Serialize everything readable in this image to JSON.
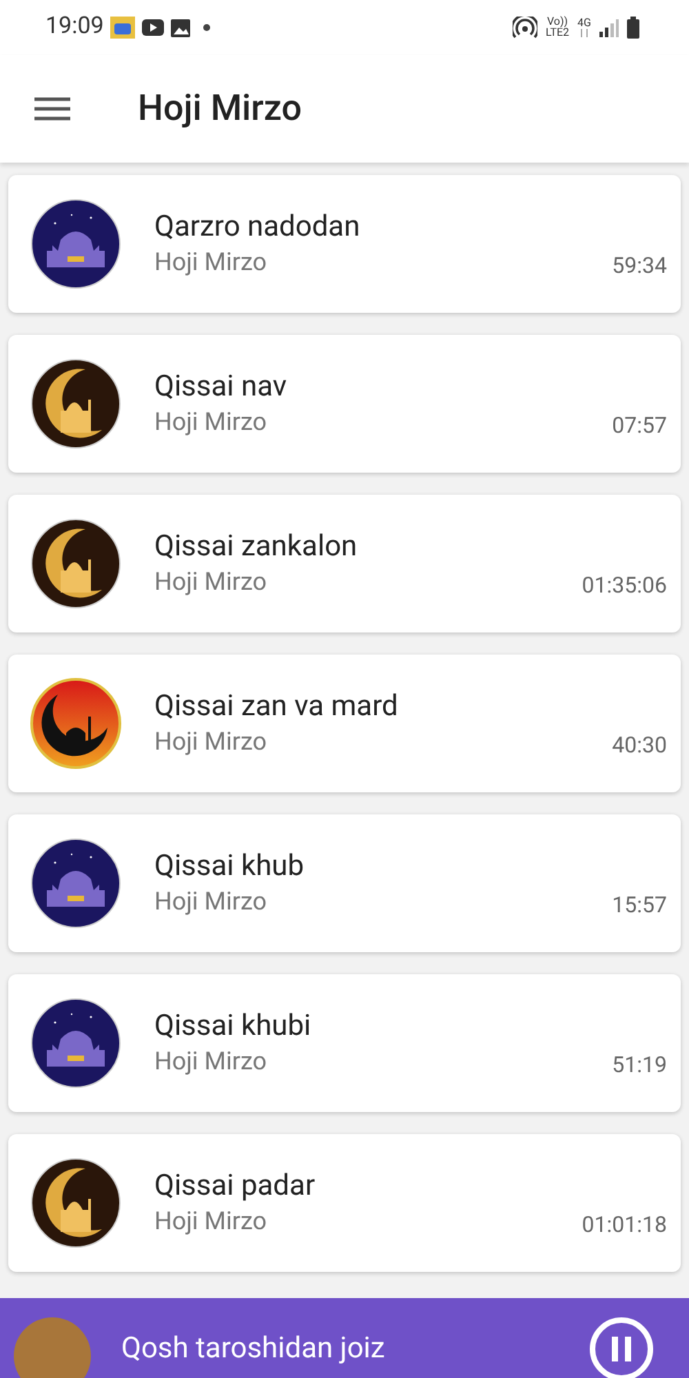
{
  "status_bar": {
    "time": "19:09",
    "network_top": "Vo))",
    "network_bottom": "LTE2",
    "network_type": "4G"
  },
  "app_bar": {
    "title": "Hoji Mirzo"
  },
  "tracks": [
    {
      "title": "Qarzro nadodan",
      "artist": "Hoji Mirzo",
      "duration": "59:34",
      "kind": "night"
    },
    {
      "title": "Qissai nav",
      "artist": "Hoji Mirzo",
      "duration": "07:57",
      "kind": "gold"
    },
    {
      "title": "Qissai zankalon",
      "artist": "Hoji Mirzo",
      "duration": "01:35:06",
      "kind": "gold"
    },
    {
      "title": "Qissai zan va mard",
      "artist": "Hoji Mirzo",
      "duration": "40:30",
      "kind": "red"
    },
    {
      "title": "Qissai khub",
      "artist": "Hoji Mirzo",
      "duration": "15:57",
      "kind": "night"
    },
    {
      "title": "Qissai khubi",
      "artist": "Hoji Mirzo",
      "duration": "51:19",
      "kind": "night"
    },
    {
      "title": "Qissai padar",
      "artist": "Hoji Mirzo",
      "duration": "01:01:18",
      "kind": "gold"
    }
  ],
  "player": {
    "title": "Qosh taroshidan joiz",
    "playing": true
  }
}
